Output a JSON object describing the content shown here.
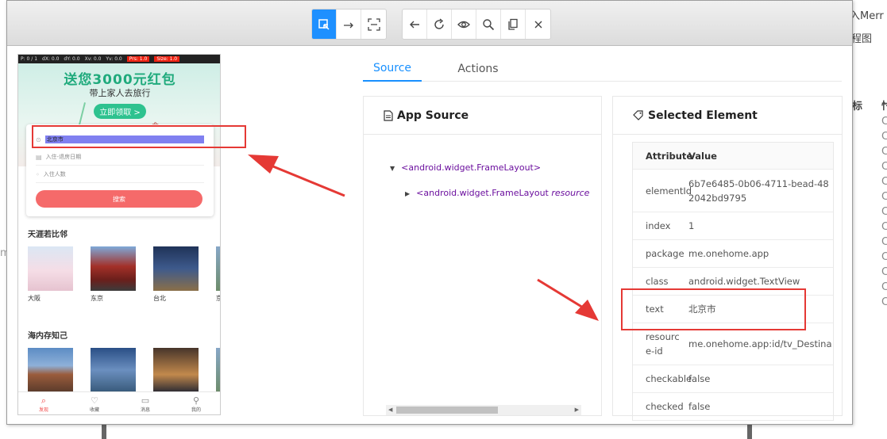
{
  "background": {
    "right_text": [
      "入Merr",
      "程图"
    ],
    "column_header_1": "标",
    "column_header_2": "忖",
    "left_fragment": "m"
  },
  "toolbar": {
    "group1": [
      {
        "icon": "select-element-icon",
        "active": true
      },
      {
        "icon": "swipe-icon",
        "active": false
      },
      {
        "icon": "tap-coordinates-icon",
        "active": false
      }
    ],
    "group2": [
      {
        "icon": "back-icon"
      },
      {
        "icon": "refresh-icon"
      },
      {
        "icon": "eye-icon"
      },
      {
        "icon": "search-icon"
      },
      {
        "icon": "copy-icon"
      },
      {
        "icon": "close-icon"
      }
    ]
  },
  "phone": {
    "statusbar": [
      "P: 0 / 1",
      "dX: 0.0",
      "dY: 0.0",
      "Xv: 0.0",
      "Yv: 0.0",
      "Prs: 1.0",
      "Size: 1.0"
    ],
    "banner_title": "送您3000元红包",
    "banner_subtitle": "带上家人去旅行",
    "banner_cta": "立即领取 >",
    "destination": "北京市",
    "date_placeholder": "入住-退房日期",
    "guests_placeholder": "入住人数",
    "search_button": "搜索",
    "section1": "天涯若比邻",
    "section1_items": [
      "大阪",
      "东京",
      "台北",
      "京"
    ],
    "section2": "海内存知己",
    "nav": [
      {
        "label": "发现",
        "icon": "search-icon",
        "active": true
      },
      {
        "label": "收藏",
        "icon": "heart-icon",
        "active": false
      },
      {
        "label": "消息",
        "icon": "message-icon",
        "active": false
      },
      {
        "label": "我的",
        "icon": "user-icon",
        "active": false
      }
    ]
  },
  "tabs": [
    "Source",
    "Actions"
  ],
  "app_source": {
    "title": "App Source",
    "nodes": [
      "<android.widget.FrameLayout>",
      "<android.widget.FrameLayout "
    ],
    "node2_attr": "resource"
  },
  "selected_element": {
    "title": "Selected Element",
    "header": {
      "attribute": "Attribute",
      "value": "Value"
    },
    "rows": [
      {
        "attribute": "elementId",
        "value": "6b7e6485-0b06-4711-bead-482042bd9795"
      },
      {
        "attribute": "index",
        "value": "1"
      },
      {
        "attribute": "package",
        "value": "me.onehome.app"
      },
      {
        "attribute": "class",
        "value": "android.widget.TextView"
      },
      {
        "attribute": "text",
        "value": "北京市"
      },
      {
        "attribute": "resource-id",
        "value": "me.onehome.app:id/tv_Destina"
      },
      {
        "attribute": "checkable",
        "value": "false"
      },
      {
        "attribute": "checked",
        "value": "false"
      }
    ]
  },
  "colors": {
    "accent": "#1890ff",
    "annotation": "#e53935"
  }
}
